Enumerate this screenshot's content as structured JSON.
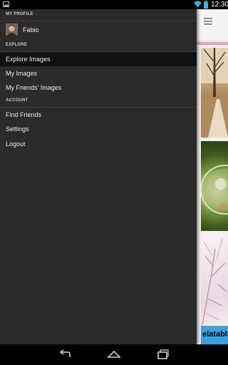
{
  "status_bar": {
    "time": "12:30",
    "icons": [
      "image-notification-icon",
      "wifi-icon",
      "battery-icon"
    ]
  },
  "drawer": {
    "profile_section": {
      "header": "MY PROFILE",
      "name": "Fabio"
    },
    "explore_section": {
      "header": "EXPLORE",
      "items": [
        {
          "label": "Explore Images",
          "active": true
        },
        {
          "label": "My Images",
          "active": false
        },
        {
          "label": "My Friends' Images",
          "active": false
        }
      ]
    },
    "account_section": {
      "header": "ACCOUNT",
      "items": [
        {
          "label": "Find Friends"
        },
        {
          "label": "Settings"
        },
        {
          "label": "Logout"
        }
      ]
    }
  },
  "background_app": {
    "menu_icon": "hamburger-icon",
    "banner_text": "elatable",
    "accent_color": "#e9a0b4"
  },
  "nav_bar": {
    "buttons": [
      "back-icon",
      "home-icon",
      "recent-apps-icon"
    ]
  },
  "colors": {
    "drawer_bg": "#2b2b2b",
    "active_item_bg": "#111111",
    "text": "#ececec"
  }
}
